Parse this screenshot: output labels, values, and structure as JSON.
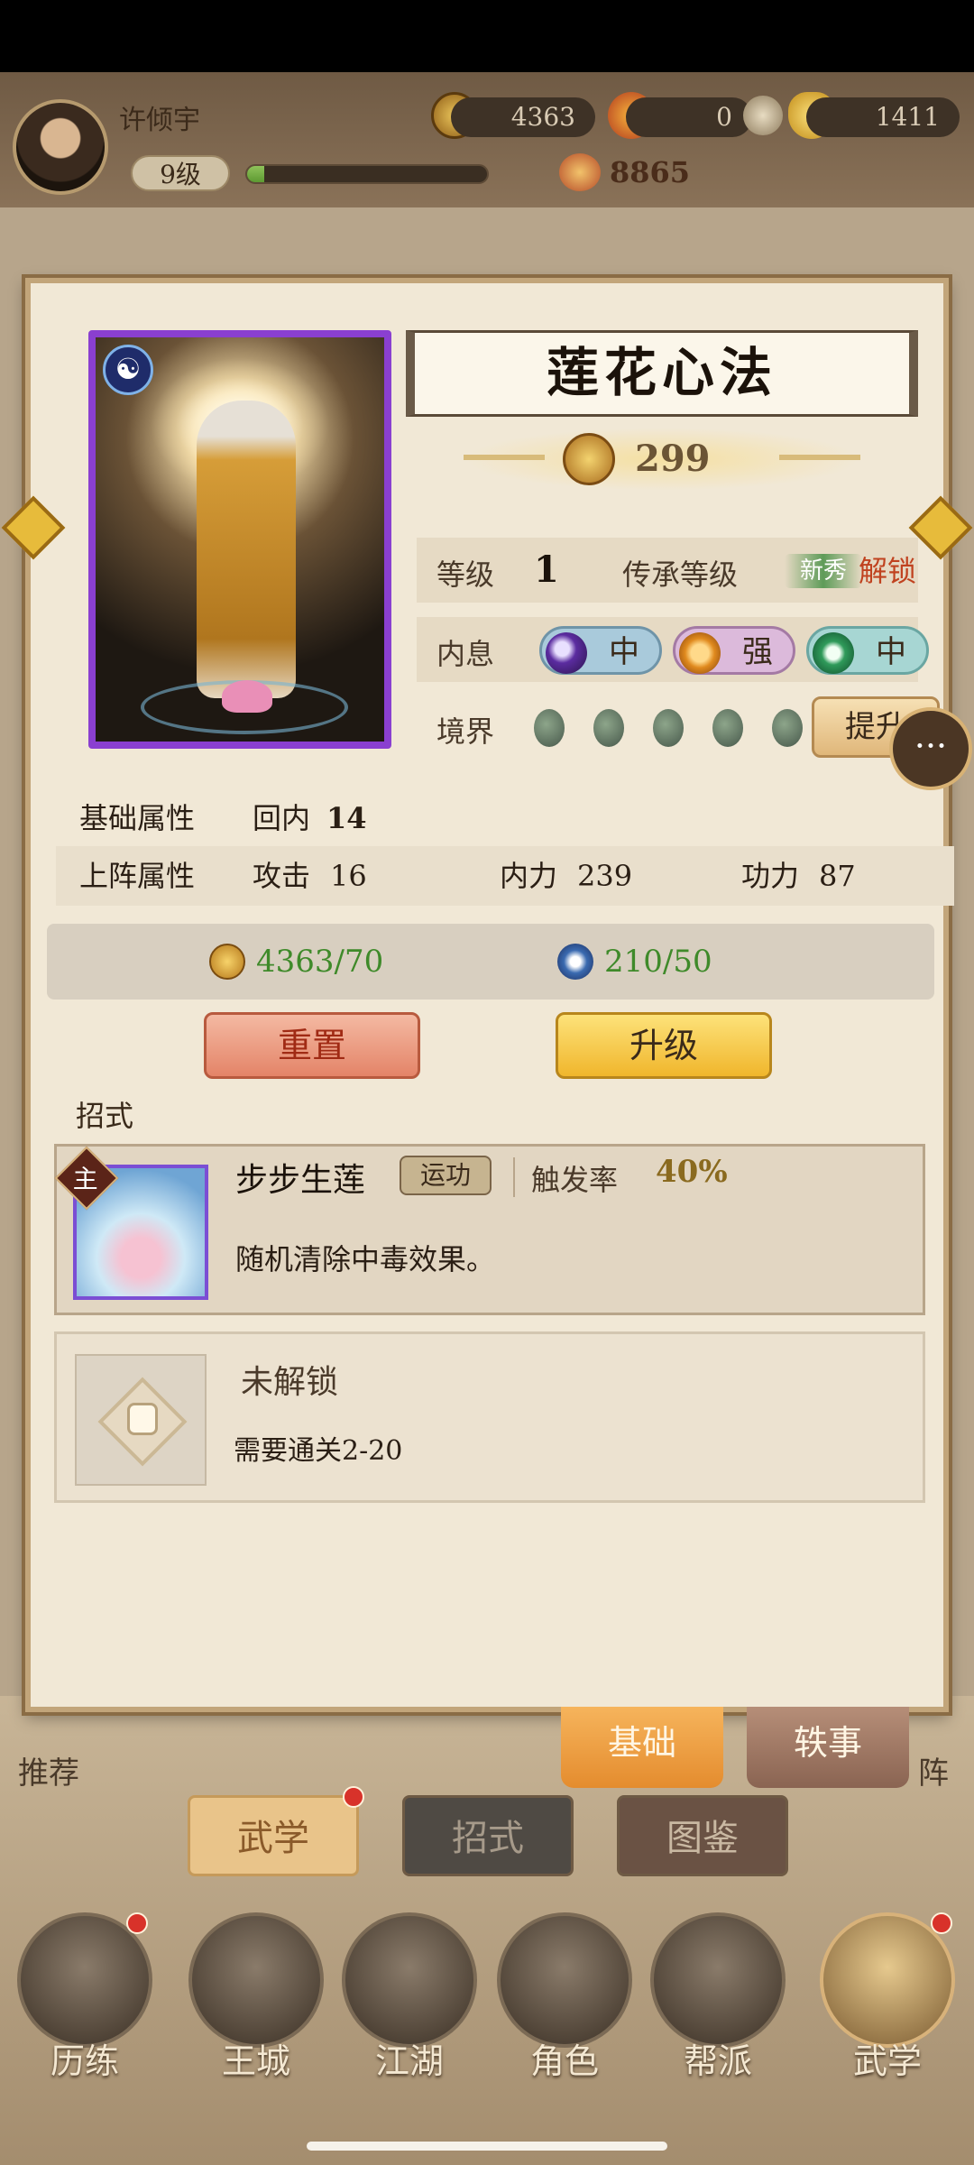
{
  "player": {
    "name": "许倾宇",
    "level": "9级",
    "xp_fraction": 0.07,
    "power": "8865"
  },
  "currencies": {
    "coins": "4363",
    "flame": "0",
    "ingots": "1411"
  },
  "skill": {
    "title": "莲花心法",
    "score": "299",
    "level_label": "等级",
    "level_value": "1",
    "inherit_label": "传承等级",
    "inherit_badge": "新秀",
    "unlock": "解锁",
    "neixi_label": "内息",
    "neixi": [
      {
        "value": "中",
        "color": "#9fc3d8",
        "icon": "moon-icon"
      },
      {
        "value": "强",
        "color": "#d9b3d9",
        "icon": "sun-icon"
      },
      {
        "value": "中",
        "color": "#9fd0cf",
        "icon": "jade-ring-icon"
      }
    ],
    "realm_label": "境界",
    "realm_drops": 5,
    "upgrade_realm": "提升"
  },
  "attributes": {
    "base_label": "基础属性",
    "base_stat_name": "回内",
    "base_stat_value": "14",
    "battle_label": "上阵属性",
    "battle_stats": [
      {
        "name": "攻击",
        "value": "16"
      },
      {
        "name": "内力",
        "value": "239"
      },
      {
        "name": "功力",
        "value": "87"
      }
    ]
  },
  "resources": {
    "coin_cost": "4363/70",
    "essence_cost": "210/50"
  },
  "buttons": {
    "reset": "重置",
    "level_up": "升级"
  },
  "moves": {
    "section_label": "招式",
    "items": [
      {
        "badge": "主",
        "name": "步步生莲",
        "tag": "运功",
        "trigger_label": "触发率",
        "trigger_value": "40%",
        "description": "随机清除中毒效果。"
      }
    ],
    "locked": {
      "title": "未解锁",
      "requirement": "需要通关2-20"
    }
  },
  "modal_tabs": [
    "基础",
    "轶事"
  ],
  "sub_tabs": [
    "武学",
    "招式",
    "图鉴"
  ],
  "side_labels": {
    "left": "推荐",
    "right": "阵"
  },
  "nav": [
    {
      "label": "历练",
      "badge": true
    },
    {
      "label": "王城",
      "badge": false
    },
    {
      "label": "江湖",
      "badge": false
    },
    {
      "label": "角色",
      "badge": false
    },
    {
      "label": "帮派",
      "badge": false
    },
    {
      "label": "武学",
      "badge": true
    }
  ]
}
